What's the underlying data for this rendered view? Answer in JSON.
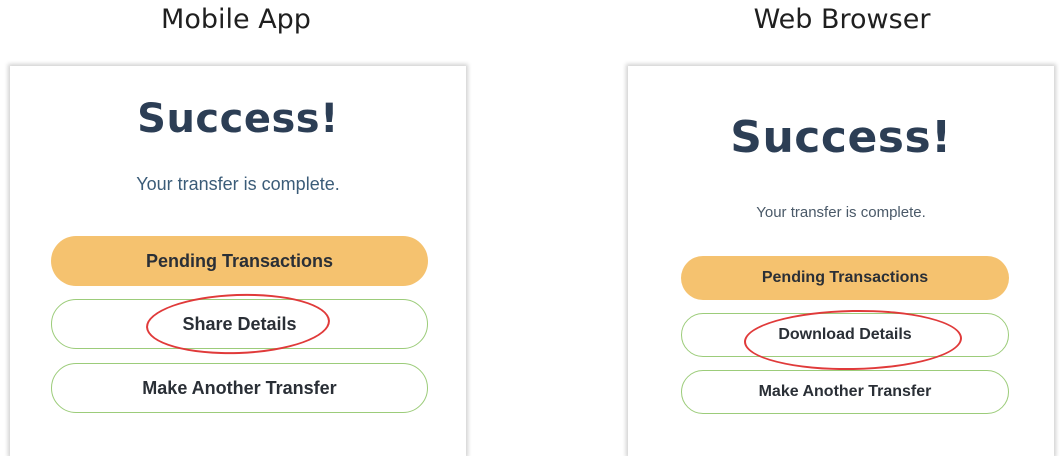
{
  "mobile": {
    "heading": "Mobile App",
    "title": "Success!",
    "subtitle": "Your transfer is complete.",
    "buttons": {
      "pending": "Pending Transactions",
      "share": "Share Details",
      "another": "Make Another Transfer"
    }
  },
  "web": {
    "heading": "Web Browser",
    "title": "Success!",
    "subtitle": "Your transfer is complete.",
    "buttons": {
      "pending": "Pending Transactions",
      "download": "Download Details",
      "another": "Make Another Transfer"
    }
  },
  "colors": {
    "title": "#2c3e55",
    "primary_button": "#f5c26f",
    "outline_button_border": "#9ccc7a",
    "annotation": "#e03a3a"
  }
}
